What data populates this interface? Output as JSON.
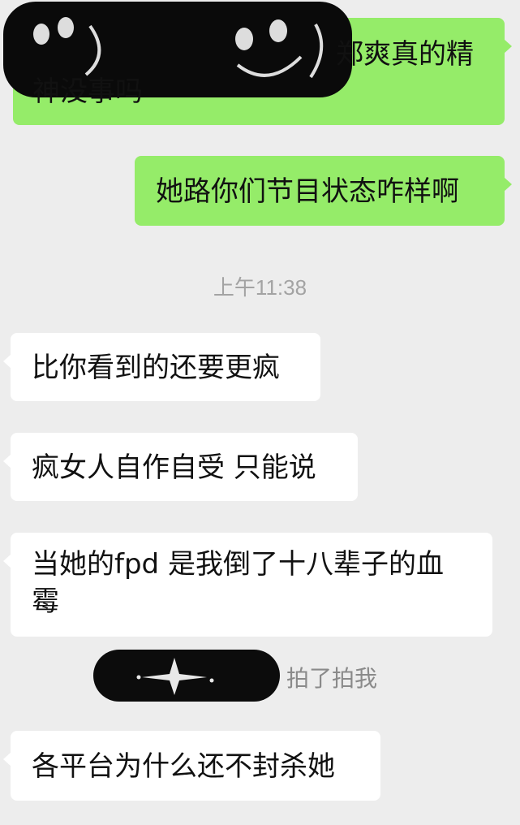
{
  "messages": [
    {
      "side": "out",
      "lines": [
        "郑爽真的精",
        "神没事吗"
      ]
    },
    {
      "side": "out",
      "lines": [
        "她路你们节目状态咋样啊"
      ]
    },
    {
      "side": "in",
      "lines": [
        "比你看到的还要更疯"
      ]
    },
    {
      "side": "in",
      "lines": [
        "疯女人自作自受 只能说"
      ]
    },
    {
      "side": "in",
      "lines": [
        "当她的fpd 是我倒了十八辈子的血",
        "霉"
      ]
    },
    {
      "side": "in",
      "lines": [
        "各平台为什么还不封杀她"
      ]
    }
  ],
  "timestamp": "上午11:38",
  "pat": {
    "text": "拍了拍我"
  },
  "icons": {
    "redacted_sticker": "smiley-sticker-icon",
    "pat_avatar": "sparkle-star-icon"
  },
  "colors": {
    "background": "#ededed",
    "outgoing_bubble": "#95ec69",
    "incoming_bubble": "#ffffff",
    "timestamp_text": "#a3a3a3"
  }
}
